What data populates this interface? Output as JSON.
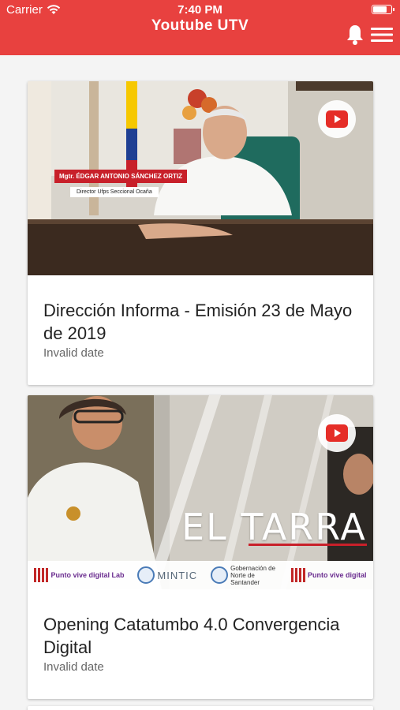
{
  "status_bar": {
    "carrier": "Carrier",
    "time": "7:40 PM",
    "battery_level": 0.8
  },
  "app_bar": {
    "title": "Youtube UTV",
    "icons": [
      "bell-icon",
      "menu-icon"
    ],
    "color": "#e8413f"
  },
  "videos": [
    {
      "title": "Dirección Informa - Emisión 23 de Mayo de 2019",
      "date": "Invalid date",
      "overlay_name": "Mgtr. ÉDGAR ANTONIO SÁNCHEZ ORTIZ",
      "overlay_role": "Director Ufps Seccional Ocaña"
    },
    {
      "title": "Opening Catatumbo 4.0 Convergencia Digital",
      "date": "Invalid date",
      "overlay_title": "EL TARRA",
      "logos": [
        "Punto vive digital Lab",
        "MINTIC",
        "Gobernación de Norte de Santander",
        "Punto vive digital"
      ]
    }
  ],
  "colors": {
    "accent": "#e8413f",
    "youtube_red": "#e52d27"
  }
}
